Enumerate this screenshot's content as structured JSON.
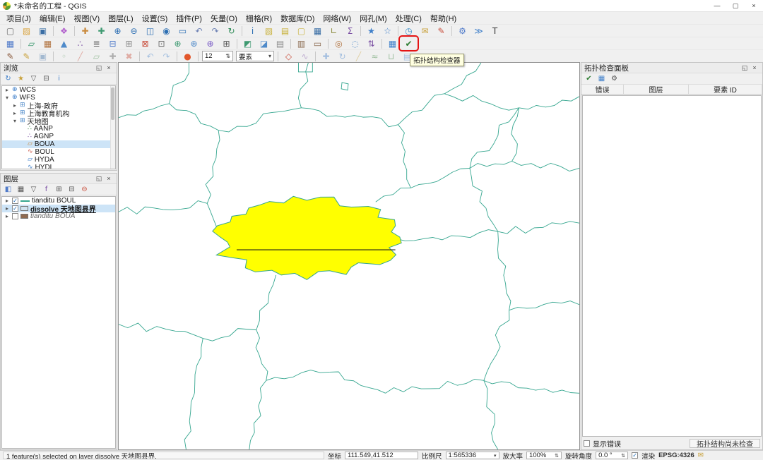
{
  "window": {
    "title": "*未命名的工程 - QGIS",
    "minimize_glyph": "—",
    "maximize_glyph": "▢",
    "close_glyph": "×"
  },
  "menubar": {
    "items": [
      "项目(J)",
      "编辑(E)",
      "视图(V)",
      "图层(L)",
      "设置(S)",
      "插件(P)",
      "矢量(O)",
      "栅格(R)",
      "数据库(D)",
      "网络(W)",
      "网孔(M)",
      "处理(C)",
      "帮助(H)"
    ]
  },
  "toolbars": {
    "row1": [
      {
        "t": "i",
        "n": "new-project",
        "g": "▢",
        "c": "#666666"
      },
      {
        "t": "i",
        "n": "open-project",
        "g": "▨",
        "c": "#d9a441"
      },
      {
        "t": "i",
        "n": "save-project",
        "g": "▣",
        "c": "#3a6ea5"
      },
      {
        "t": "s"
      },
      {
        "t": "i",
        "n": "style-manager",
        "g": "❖",
        "c": "#b05ccc"
      },
      {
        "t": "s"
      },
      {
        "t": "i",
        "n": "pan-map",
        "g": "✚",
        "c": "#c98a3d"
      },
      {
        "t": "i",
        "n": "pan-to-selection",
        "g": "✚",
        "c": "#3d9970"
      },
      {
        "t": "i",
        "n": "zoom-in",
        "g": "⊕",
        "c": "#2d6fb3"
      },
      {
        "t": "i",
        "n": "zoom-out",
        "g": "⊖",
        "c": "#2d6fb3"
      },
      {
        "t": "i",
        "n": "zoom-full",
        "g": "◫",
        "c": "#2d6fb3"
      },
      {
        "t": "i",
        "n": "zoom-to-selection",
        "g": "◉",
        "c": "#2d6fb3"
      },
      {
        "t": "i",
        "n": "zoom-to-layer",
        "g": "▭",
        "c": "#2d6fb3"
      },
      {
        "t": "i",
        "n": "zoom-last",
        "g": "↶",
        "c": "#6a7fb3"
      },
      {
        "t": "i",
        "n": "zoom-next",
        "g": "↷",
        "c": "#6a7fb3"
      },
      {
        "t": "i",
        "n": "refresh-map",
        "g": "↻",
        "c": "#2e8b57"
      },
      {
        "t": "s"
      },
      {
        "t": "i",
        "n": "identify-features",
        "g": "i",
        "c": "#2d6fb3"
      },
      {
        "t": "i",
        "n": "select-features",
        "g": "▧",
        "c": "#c9b23d"
      },
      {
        "t": "i",
        "n": "select-by-expression",
        "g": "▤",
        "c": "#c9b23d"
      },
      {
        "t": "i",
        "n": "deselect-features",
        "g": "▢",
        "c": "#c9b23d"
      },
      {
        "t": "i",
        "n": "open-attribute-table",
        "g": "▦",
        "c": "#3a6ea5"
      },
      {
        "t": "i",
        "n": "measure-line",
        "g": "∟",
        "c": "#8a8a3d"
      },
      {
        "t": "i",
        "n": "statistical-summary",
        "g": "Σ",
        "c": "#7a4fa3"
      },
      {
        "t": "s"
      },
      {
        "t": "i",
        "n": "new-bookmark",
        "g": "★",
        "c": "#3d7ec9"
      },
      {
        "t": "i",
        "n": "show-bookmarks",
        "g": "☆",
        "c": "#3d7ec9"
      },
      {
        "t": "s"
      },
      {
        "t": "i",
        "n": "temporal-controller",
        "g": "◷",
        "c": "#3d8ec9"
      },
      {
        "t": "i",
        "n": "map-tips",
        "g": "✉",
        "c": "#c9a23d"
      },
      {
        "t": "i",
        "n": "new-annotation",
        "g": "✎",
        "c": "#c94f3d"
      },
      {
        "t": "s"
      },
      {
        "t": "i",
        "n": "processing-toolbox",
        "g": "⚙",
        "c": "#4f7ac9"
      },
      {
        "t": "i",
        "n": "python-console",
        "g": "≫",
        "c": "#3d7ec9"
      },
      {
        "t": "i",
        "n": "text-annotation",
        "g": "T",
        "c": "#333333"
      }
    ],
    "row2": [
      {
        "t": "i",
        "n": "datasource-manager",
        "g": "▦",
        "c": "#4f7ac9"
      },
      {
        "t": "s"
      },
      {
        "t": "i",
        "n": "add-vector-layer",
        "g": "▱",
        "c": "#3d9970"
      },
      {
        "t": "i",
        "n": "add-raster-layer",
        "g": "▦",
        "c": "#b0713d"
      },
      {
        "t": "i",
        "n": "add-mesh-layer",
        "g": "▲",
        "c": "#4f8ac9"
      },
      {
        "t": "i",
        "n": "add-point-cloud-layer",
        "g": "∴",
        "c": "#7a4fa3"
      },
      {
        "t": "i",
        "n": "add-delimited-text-layer",
        "g": "≣",
        "c": "#6a6a6a"
      },
      {
        "t": "i",
        "n": "add-postgis-layer",
        "g": "⊟",
        "c": "#4f7ac9"
      },
      {
        "t": "i",
        "n": "add-spatialite-layer",
        "g": "⊞",
        "c": "#8a8a8a"
      },
      {
        "t": "i",
        "n": "add-oracle-layer",
        "g": "⊠",
        "c": "#c94f3d"
      },
      {
        "t": "i",
        "n": "add-virtual-layer",
        "g": "⊡",
        "c": "#6a6a6a"
      },
      {
        "t": "i",
        "n": "add-wms-layer",
        "g": "⊕",
        "c": "#3d9970"
      },
      {
        "t": "i",
        "n": "add-wcs-layer",
        "g": "⊕",
        "c": "#4f8ac9"
      },
      {
        "t": "i",
        "n": "add-wfs-layer",
        "g": "⊕",
        "c": "#7a5cc6"
      },
      {
        "t": "i",
        "n": "add-xyz-layer",
        "g": "⊞",
        "c": "#555555"
      },
      {
        "t": "s"
      },
      {
        "t": "i",
        "n": "new-shapefile-layer",
        "g": "◩",
        "c": "#3d9970"
      },
      {
        "t": "i",
        "n": "new-geopackage-layer",
        "g": "◪",
        "c": "#4f8ac9"
      },
      {
        "t": "i",
        "n": "new-scratch-layer",
        "g": "▤",
        "c": "#8a8a8a"
      },
      {
        "t": "s"
      },
      {
        "t": "i",
        "n": "layout-manager",
        "g": "▥",
        "c": "#8a6a4f"
      },
      {
        "t": "i",
        "n": "show-layout",
        "g": "▭",
        "c": "#8a6a4f"
      },
      {
        "t": "s"
      },
      {
        "t": "i",
        "n": "georeferencer",
        "g": "◎",
        "c": "#b0713d"
      },
      {
        "t": "i",
        "n": "metasearch",
        "g": "◌",
        "c": "#4f8ac9"
      },
      {
        "t": "i",
        "n": "offline-editing",
        "g": "⇅",
        "c": "#7a4fa3"
      },
      {
        "t": "s"
      },
      {
        "t": "i",
        "n": "check-geometries",
        "g": "▦",
        "c": "#3d7ec9"
      },
      {
        "t": "i",
        "n": "topology-checker",
        "g": "✔",
        "c": "#2e7d32",
        "hl": 1
      }
    ],
    "row3": [
      {
        "t": "i",
        "n": "current-edits",
        "g": "✎",
        "c": "#8a5a3d"
      },
      {
        "t": "i",
        "n": "toggle-editing",
        "g": "✎",
        "c": "#c9a23d"
      },
      {
        "t": "i",
        "n": "save-layer-edits",
        "g": "▣",
        "c": "#3a6ea5",
        "d": 1
      },
      {
        "t": "s"
      },
      {
        "t": "i",
        "n": "digitize-point",
        "g": "◦",
        "c": "#2e7d32",
        "d": 1
      },
      {
        "t": "i",
        "n": "digitize-line",
        "g": "╱",
        "c": "#c94f3d",
        "d": 1
      },
      {
        "t": "i",
        "n": "digitize-polygon",
        "g": "▱",
        "c": "#2e7d32",
        "d": 1
      },
      {
        "t": "i",
        "n": "vertex-tool",
        "g": "✚",
        "c": "#555555",
        "d": 1
      },
      {
        "t": "i",
        "n": "delete-selected",
        "g": "✖",
        "c": "#c94f3d",
        "d": 1
      },
      {
        "t": "s"
      },
      {
        "t": "i",
        "n": "undo",
        "g": "↶",
        "c": "#3d7ec9",
        "d": 1
      },
      {
        "t": "i",
        "n": "redo",
        "g": "↷",
        "c": "#3d7ec9",
        "d": 1
      },
      {
        "t": "s"
      },
      {
        "t": "i",
        "n": "osm-marker",
        "g": "●",
        "c": "#e2572b"
      },
      {
        "t": "s"
      },
      {
        "t": "c",
        "n": "snap-tolerance",
        "v": "12",
        "w": 44,
        "a": "spin"
      },
      {
        "t": "c",
        "n": "snap-mode",
        "v": "要素",
        "w": 54,
        "a": "drop"
      },
      {
        "t": "s"
      },
      {
        "t": "i",
        "n": "snapping-toggle",
        "g": "◇",
        "c": "#c94f3d"
      },
      {
        "t": "i",
        "n": "tracing-toggle",
        "g": "∿",
        "c": "#7a4fa3",
        "d": 1
      },
      {
        "t": "s"
      },
      {
        "t": "i",
        "n": "move-feature",
        "g": "✚",
        "c": "#3d7ec9",
        "d": 1
      },
      {
        "t": "i",
        "n": "rotate-feature",
        "g": "↻",
        "c": "#3d7ec9",
        "d": 1
      },
      {
        "t": "i",
        "n": "split-features",
        "g": "╱",
        "c": "#c9a23d",
        "d": 1
      },
      {
        "t": "i",
        "n": "reshape-features",
        "g": "≈",
        "c": "#2e7d32",
        "d": 1
      },
      {
        "t": "i",
        "n": "merge-features",
        "g": "⊔",
        "c": "#2e7d32",
        "d": 1
      },
      {
        "t": "i",
        "n": "modify-attributes",
        "g": "▤",
        "c": "#3d7ec9",
        "d": 1
      },
      {
        "t": "i",
        "n": "more-digitizing",
        "g": "⋯",
        "c": "#555555"
      }
    ]
  },
  "annotation": {
    "tooltip": "拓扑结构检查器",
    "accent_color": "#e51414"
  },
  "browser_panel": {
    "title": "浏览",
    "toolbar": [
      {
        "n": "refresh-browser",
        "g": "↻",
        "c": "#3d7ec9"
      },
      {
        "n": "add-favorite",
        "g": "★",
        "c": "#c9a23d"
      },
      {
        "n": "filter-browser",
        "g": "▽",
        "c": "#555555"
      },
      {
        "n": "collapse-all-browser",
        "g": "⊟",
        "c": "#555555"
      },
      {
        "n": "browser-properties",
        "g": "i",
        "c": "#3d7ec9"
      }
    ],
    "tree": [
      {
        "label": "WCS",
        "level": 0,
        "expand": true,
        "expanded": false,
        "icon": "wcs-service",
        "g": "⊕",
        "c": "#3d7ec9"
      },
      {
        "label": "WFS",
        "level": 0,
        "expand": true,
        "expanded": true,
        "icon": "wfs-service",
        "g": "⊕",
        "c": "#3d7ec9"
      },
      {
        "label": "上海-政府",
        "level": 1,
        "expand": true,
        "expanded": false,
        "icon": "wfs-connection",
        "g": "⊞",
        "c": "#4f8ac9"
      },
      {
        "label": "上海教育机构",
        "level": 1,
        "expand": true,
        "expanded": false,
        "icon": "wfs-connection",
        "g": "⊞",
        "c": "#4f8ac9"
      },
      {
        "label": "天地图",
        "level": 1,
        "expand": true,
        "expanded": true,
        "icon": "wfs-connection",
        "g": "⊞",
        "c": "#4f8ac9"
      },
      {
        "label": "AANP",
        "level": 2,
        "icon": "point-layer",
        "g": "∴",
        "c": "#2e7d32"
      },
      {
        "label": "AGNP",
        "level": 2,
        "icon": "point-layer",
        "g": "∴",
        "c": "#7a4fa3"
      },
      {
        "label": "BOUA",
        "level": 2,
        "selected": true,
        "icon": "polygon-layer",
        "g": "▱",
        "c": "#c98a3d"
      },
      {
        "label": "BOUL",
        "level": 2,
        "icon": "line-layer",
        "g": "∿",
        "c": "#c94f3d"
      },
      {
        "label": "HYDA",
        "level": 2,
        "icon": "polygon-layer",
        "g": "▱",
        "c": "#3d7ec9"
      },
      {
        "label": "HYDL",
        "level": 2,
        "icon": "line-layer",
        "g": "∿",
        "c": "#3d7ec9"
      }
    ]
  },
  "layers_panel": {
    "title": "图层",
    "toolbar": [
      {
        "n": "layer-styling",
        "g": "◧",
        "c": "#4f7ac9"
      },
      {
        "n": "manage-map-themes",
        "g": "▦",
        "c": "#555555"
      },
      {
        "n": "filter-legend",
        "g": "▽",
        "c": "#555555"
      },
      {
        "n": "filter-by-expression",
        "g": "f",
        "c": "#7a4fa3"
      },
      {
        "n": "expand-all-layers",
        "g": "⊞",
        "c": "#555555"
      },
      {
        "n": "collapse-all-layers",
        "g": "⊟",
        "c": "#555555"
      },
      {
        "n": "remove-layer",
        "g": "⊖",
        "c": "#c94f3d"
      }
    ],
    "items": [
      {
        "label": "tianditu BOUL",
        "checked": true,
        "swatch": "line",
        "swatch_color": "#35a68f"
      },
      {
        "label": "dissolve 天地图县界",
        "checked": true,
        "selected": true,
        "underline": true,
        "bold": true,
        "swatch": "fill",
        "swatch_color": "#cfe3f0"
      },
      {
        "label": "tianditu BOUA",
        "checked": false,
        "italic": true,
        "swatch": "fill",
        "swatch_color": "#8f6b52"
      }
    ]
  },
  "map": {
    "background": "#ffffff",
    "boundary_color": "#35a68f",
    "selection_fill": "#ffff00",
    "dissolve_line_color": "#1a1a1a"
  },
  "topology_panel": {
    "title": "拓扑检查面板",
    "toolbar": [
      {
        "n": "validate-all",
        "g": "✔",
        "c": "#2e7d32"
      },
      {
        "n": "validate-extent",
        "g": "▦",
        "c": "#3d7ec9"
      },
      {
        "n": "configure-topology",
        "g": "⚙",
        "c": "#555555"
      }
    ],
    "columns": [
      "错误",
      "图层",
      "要素 ID"
    ],
    "show_errors_label": "显示错误",
    "status_label": "拓扑结构尚未检查"
  },
  "statusbar": {
    "message": "1 feature(s) selected on layer dissolve 天地图县界.",
    "coordinate_label": "坐标",
    "coordinate_value": "111.549,41.512",
    "scale_label": "比例尺",
    "scale_value": "1:565336",
    "magnifier_label": "放大率",
    "magnifier_value": "100%",
    "rotation_label": "旋转角度",
    "rotation_value": "0.0 °",
    "render_label": "渲染",
    "crs": "EPSG:4326"
  }
}
